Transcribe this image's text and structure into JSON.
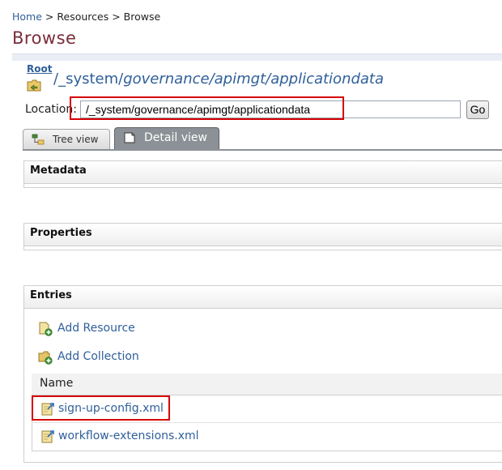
{
  "breadcrumb": {
    "items": [
      "Home",
      "Resources",
      "Browse"
    ],
    "separator": ">"
  },
  "page": {
    "title": "Browse"
  },
  "root": {
    "label": "Root",
    "path_prefix": "/_system/",
    "path_rest": "governance/apimgt/applicationdata"
  },
  "location": {
    "label": "Location:",
    "value": "/_system/governance/apimgt/applicationdata",
    "go_label": "Go"
  },
  "tabs": [
    {
      "label": "Tree view",
      "active": false
    },
    {
      "label": "Detail view",
      "active": true
    }
  ],
  "sections": {
    "metadata": "Metadata",
    "properties": "Properties",
    "entries": "Entries"
  },
  "entries": {
    "add_resource": "Add Resource",
    "add_collection": "Add Collection",
    "column_name": "Name",
    "rows": [
      "sign-up-config.xml",
      "workflow-extensions.xml"
    ]
  },
  "colors": {
    "link": "#2f5f9a",
    "title": "#7b2d3a",
    "highlight": "#d60000",
    "active_tab": "#8b9196"
  }
}
